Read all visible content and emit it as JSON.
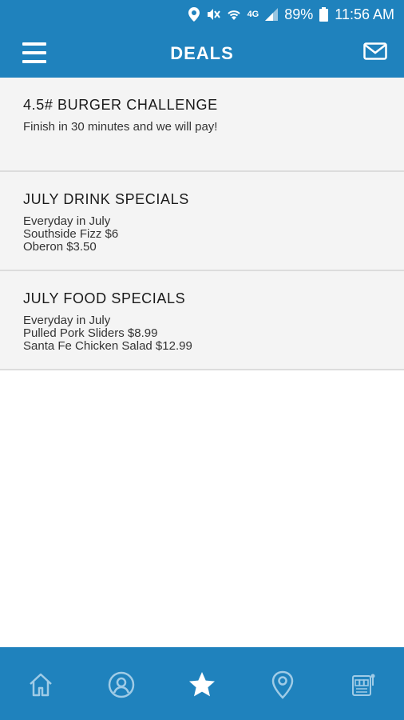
{
  "status_bar": {
    "battery": "89%",
    "time": "11:56 AM",
    "network": "4G",
    "icons": [
      "location-icon",
      "mute-icon",
      "wifi-icon",
      "signal-icon",
      "battery-icon"
    ]
  },
  "header": {
    "title": "DEALS",
    "menu_icon": "hamburger-menu-icon",
    "mail_icon": "mail-icon"
  },
  "deals": [
    {
      "title": "4.5# BURGER CHALLENGE",
      "body": "Finish in 30 minutes and we will pay!"
    },
    {
      "title": "JULY DRINK SPECIALS",
      "body": "Everyday in July\nSouthside Fizz $6\nOberon $3.50"
    },
    {
      "title": "JULY FOOD SPECIALS",
      "body": "Everyday in July\nPulled Pork Sliders $8.99\nSanta Fe Chicken Salad $12.99"
    }
  ],
  "tab_bar": {
    "tabs": [
      "home-icon",
      "profile-icon",
      "star-icon",
      "location-pin-icon",
      "slot-machine-icon"
    ],
    "active": "star-icon",
    "active_color": "#ffffff",
    "inactive_color": "#9fcbe6"
  },
  "colors": {
    "brand": "#1f82bd",
    "card_bg": "#f4f4f4",
    "divider": "#dcdcdc"
  }
}
